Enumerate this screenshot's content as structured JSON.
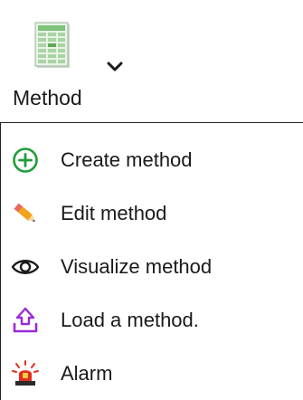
{
  "toolbar": {
    "button_label": "Method",
    "icon": "spreadsheet-icon",
    "dropdown_icon": "chevron-down-icon"
  },
  "menu": {
    "items": [
      {
        "label": "Create method",
        "icon": "add-circle-icon",
        "icon_color": "#1f9e3a"
      },
      {
        "label": "Edit method",
        "icon": "pencil-icon",
        "icon_color": "#f3a21b"
      },
      {
        "label": "Visualize method",
        "icon": "eye-icon",
        "icon_color": "#1a1a1a"
      },
      {
        "label": "Load a method.",
        "icon": "upload-icon",
        "icon_color": "#9b2bd6"
      },
      {
        "label": "Alarm",
        "icon": "siren-icon",
        "icon_color": "#e0301e"
      }
    ]
  }
}
